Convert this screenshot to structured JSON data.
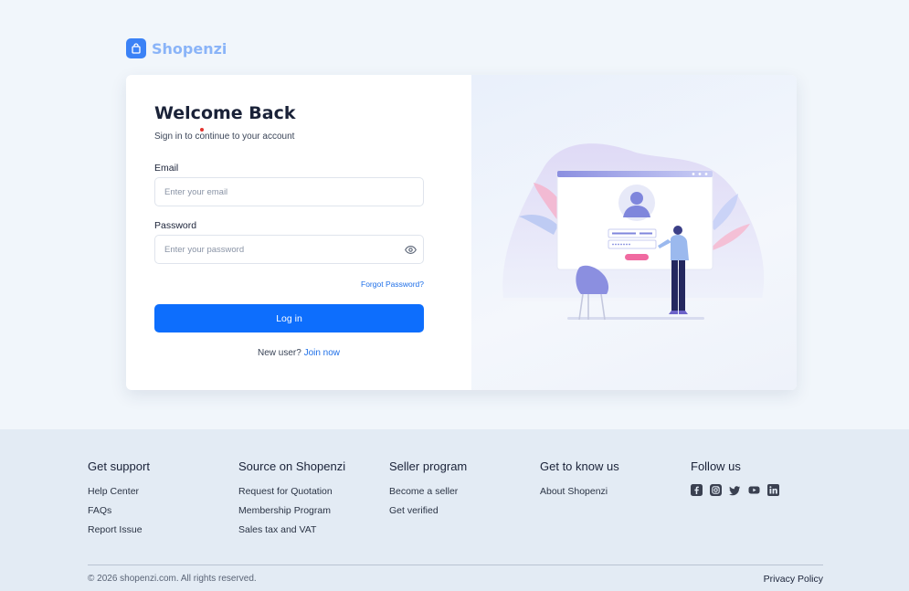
{
  "brand": {
    "name": "Shopenzi",
    "icon": "shopping-bag-icon",
    "color": "#3b82f6"
  },
  "login": {
    "title": "Welcome Back",
    "subtitle": "Sign in to continue to your account",
    "email_label": "Email",
    "email_placeholder": "Enter your email",
    "password_label": "Password",
    "password_placeholder": "Enter your password",
    "forgot": "Forgot Password?",
    "submit": "Log in",
    "new_user": "New user?",
    "join": "Join now",
    "accent": "#0d6efd"
  },
  "footer": {
    "columns": [
      {
        "title": "Get support",
        "links": [
          "Help Center",
          "FAQs",
          "Report Issue"
        ]
      },
      {
        "title": "Source on Shopenzi",
        "links": [
          "Request for Quotation",
          "Membership Program",
          "Sales tax and VAT"
        ]
      },
      {
        "title": "Seller program",
        "links": [
          "Become a seller",
          "Get verified"
        ]
      },
      {
        "title": "Get to know us",
        "links": [
          "About Shopenzi"
        ]
      }
    ],
    "follow_title": "Follow us",
    "social_icons": [
      "facebook-icon",
      "instagram-icon",
      "twitter-icon",
      "youtube-icon",
      "linkedin-icon"
    ],
    "copyright": "© 2026 shopenzi.com. All rights reserved.",
    "privacy": "Privacy Policy"
  }
}
